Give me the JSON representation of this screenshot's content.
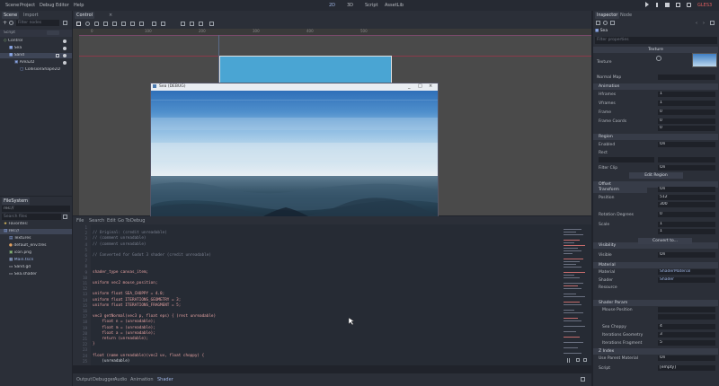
{
  "topbar": {
    "menus": [
      "Scene",
      "Project",
      "Debug",
      "Editor",
      "Help"
    ],
    "modes": [
      "2D",
      "3D",
      "Script",
      "AssetLib"
    ],
    "renderer": "GLES3"
  },
  "scene_dock": {
    "tabs": [
      "Scene",
      "Import"
    ],
    "filter_placeholder": "Filter nodes",
    "script_label": "Script",
    "nodes": [
      "Control",
      "Sea",
      "Sand",
      "Area2D",
      "CollisionShape2D"
    ]
  },
  "filesystem_dock": {
    "tab": "FileSystem",
    "path": "res://",
    "search_placeholder": "Search files",
    "folder_label": "Favorites:",
    "items": [
      "res://",
      "Textures",
      "default_env.tres",
      "icon.png",
      "Main.tscn",
      "Sand.gd",
      "Sea.shader"
    ]
  },
  "viewport": {
    "tab": "Control",
    "ruler_marks": [
      "0",
      "100",
      "200",
      "300",
      "400",
      "500"
    ]
  },
  "game_window": {
    "title": "Sea (DEBUG)",
    "controls": [
      "_",
      "□",
      "×"
    ]
  },
  "script_editor": {
    "menu": [
      "File",
      "Search",
      "Edit",
      "Go To",
      "Debug"
    ],
    "line_numbers": [
      "1",
      "2",
      "3",
      "4",
      "5",
      "6",
      "7",
      "8",
      "9",
      "10",
      "11",
      "12",
      "13",
      "14",
      "15",
      "16",
      "17",
      "18",
      "19",
      "20",
      "21",
      "22",
      "23",
      "24",
      "25"
    ],
    "lines": [
      "",
      "// Original: (credit unreadable)",
      "// (comment unreadable)",
      "// (comment unreadable)",
      "",
      "// Converted for Godot 3 shader (credit unreadable)",
      "",
      "",
      "shader_type canvas_item;",
      "",
      "uniform vec2 mouse_position;",
      "",
      "uniform float SEA_CHOPPY = 4.0;",
      "uniform float ITERATIONS_GEOMETRY = 3;",
      "uniform float ITERATIONS_FRAGMENT = 5;",
      "",
      "vec3 getNormal(vec3 p, float eps) { (rest unreadable)",
      "    float n = (unreadable);",
      "    float m = (unreadable);",
      "    float a = (unreadable);",
      "    return (unreadable);",
      "}",
      "",
      "float (name unreadable)(vec2 uv, float choppy) {",
      "    (unreadable)"
    ]
  },
  "bottom_bar": {
    "tabs": [
      "Output",
      "Debugger",
      "Audio",
      "Animation",
      "Shader"
    ]
  },
  "inspector": {
    "tabs": [
      "Inspector",
      "Node"
    ],
    "filter_placeholder": "Filter properties",
    "node_name": "Sea",
    "sections": {
      "texture": "Texture",
      "animation": "Animation",
      "region": "Region",
      "offset": "Offset",
      "transform": "Transform",
      "visibility": "Visibility",
      "material": "Material",
      "shader_params": "Shader Param",
      "z_index": "Z Index"
    },
    "labels": {
      "texture": "Texture",
      "normal_map": "Normal Map",
      "hframes": "Hframes",
      "vframes": "Vframes",
      "frame": "Frame",
      "frame_coords": "Frame Coords",
      "enabled": "Enabled",
      "rect": "Rect",
      "filter_clip": "Filter Clip",
      "centered": "Centered",
      "position": "Position",
      "rotation": "Rotation Degrees",
      "scale": "Scale",
      "visible": "Visible",
      "material": "Material",
      "shader": "Shader",
      "resource": "Resource",
      "sea_choppy": "Sea Choppy",
      "iter_geom": "Iterations Geometry",
      "iter_frag": "Iterations Fragment",
      "mouse_position": "Mouse Position",
      "use_parent_material": "Use Parent Material",
      "script": "Script"
    },
    "values": {
      "hframes": "1",
      "vframes": "1",
      "frame": "0",
      "frame_x": "0",
      "frame_y": "0",
      "enabled": "On",
      "filter_clip": "On",
      "centered": "On",
      "position_x": "512",
      "position_y": "300",
      "rotation": "0",
      "scale_x": "1",
      "scale_y": "1",
      "visible": "On",
      "material": "ShaderMaterial",
      "shader": "Shader",
      "sea_choppy": "4",
      "iter_geom": "3",
      "iter_frag": "5",
      "use_parent_material": "On",
      "script": "[empty]"
    },
    "buttons": {
      "edit_region": "Edit Region",
      "convert": "Convert to..."
    }
  },
  "window_controls": [
    "_",
    "□",
    "×"
  ]
}
